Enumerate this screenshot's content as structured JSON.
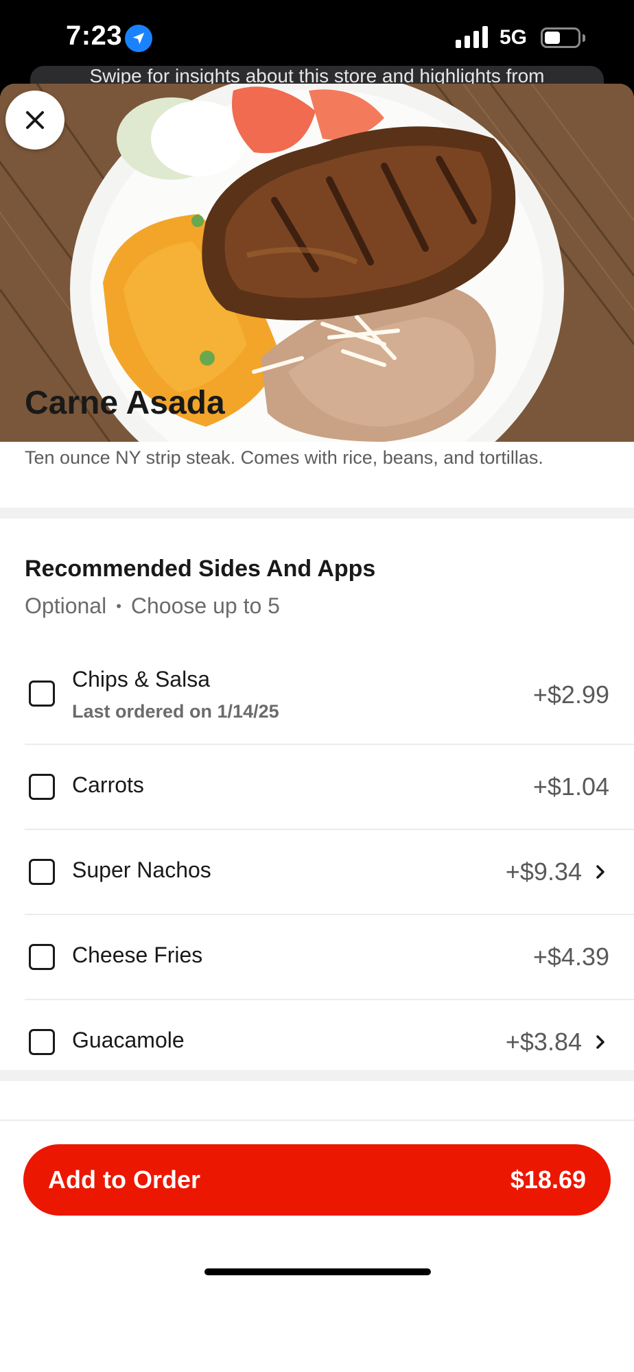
{
  "status_bar": {
    "time": "7:23",
    "network": "5G",
    "battery_level": 0.48,
    "icons": [
      "location-arrow-icon",
      "cellular-signal-icon",
      "battery-icon"
    ]
  },
  "banner": {
    "text": "Swipe for insights about this store and highlights from"
  },
  "item": {
    "title": "Carne Asada",
    "description": "Ten ounce NY strip steak. Comes with rice, beans, and tortillas.",
    "close_icon": "close-icon"
  },
  "section": {
    "title": "Recommended Sides And Apps",
    "optional": "Optional",
    "separator": "•",
    "limit": "Choose up to 5",
    "options": [
      {
        "name": "Chips & Salsa",
        "note": "Last ordered on 1/14/25",
        "price": "+$2.99",
        "has_chevron": false
      },
      {
        "name": "Carrots",
        "price": "+$1.04",
        "has_chevron": false
      },
      {
        "name": "Super Nachos",
        "price": "+$9.34",
        "has_chevron": true
      },
      {
        "name": "Cheese Fries",
        "price": "+$4.39",
        "has_chevron": false
      },
      {
        "name": "Guacamole",
        "price": "+$3.84",
        "has_chevron": true
      }
    ]
  },
  "footer": {
    "add_label": "Add to Order",
    "total": "$18.69"
  },
  "colors": {
    "accent": "#eb1700",
    "text_primary": "#191919",
    "text_secondary": "#6b6b6b"
  }
}
